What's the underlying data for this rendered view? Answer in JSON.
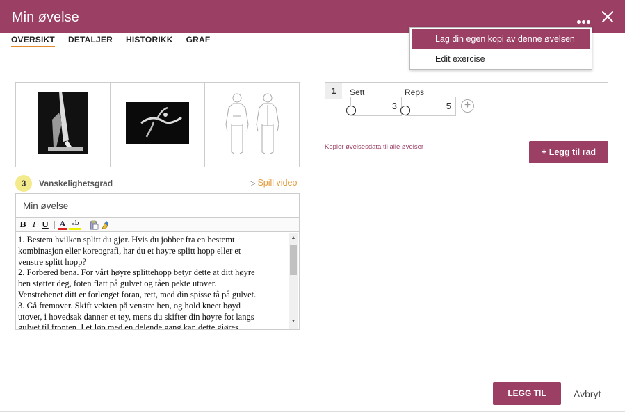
{
  "header": {
    "title": "Min øvelse",
    "accent_color": "#9b3f64",
    "more_icon": "more-horizontal-icon",
    "close_icon": "close-icon"
  },
  "tabs": [
    {
      "label": "OVERSIKT",
      "active": true
    },
    {
      "label": "DETALJER",
      "active": false
    },
    {
      "label": "HISTORIKK",
      "active": false
    },
    {
      "label": "GRAF",
      "active": false
    }
  ],
  "dropdown": {
    "items": [
      {
        "label": "Lag din egen kopi av denne øvelsen",
        "active": true
      },
      {
        "label": "Edit exercise",
        "active": false
      }
    ]
  },
  "difficulty": {
    "value": "3",
    "label": "Vanskelighetsgrad"
  },
  "play_video": {
    "icon": "play-outline-icon",
    "label": "Spill video"
  },
  "exercise_name": "Min øvelse",
  "editor": {
    "toolbar": {
      "bold": "B",
      "italic": "I",
      "underline": "U",
      "font_color": "A",
      "highlight": "ab",
      "paste_icon": "paste-icon",
      "clear_format_icon": "clear-format-icon"
    },
    "lines": [
      "1. Bestem hvilken splitt du gjør. Hvis du jobber fra en bestemt",
      "kombinasjon eller koreografi, har du et høyre splitt hopp eller et",
      "venstre splitt hopp?",
      "2. Forbered bena. For vårt høyre splittehopp betyr dette at ditt høyre",
      "ben støtter deg, foten flatt på gulvet og tåen pekte utover.",
      "Venstrebenet ditt er forlenget foran, rett, med din spisse tå på gulvet.",
      "3. Gå fremover. Skift vekten på venstre ben, og hold kneet bøyd",
      "utover, i hovedsak danner et tøy, mens du skifter din høyre fot langs",
      "gulvet til fronten. I et løp med en delende gang kan dette gjøres"
    ]
  },
  "sets": {
    "row_number": "1",
    "sett_label": "Sett",
    "sett_value": "3",
    "reps_label": "Reps",
    "reps_value": "5"
  },
  "copy_link": "Kopier øvelsesdata til alle øvelser",
  "add_row_button": "+ Legg til rad",
  "footer": {
    "add_button": "LEGG TIL",
    "cancel_button": "Avbryt"
  }
}
